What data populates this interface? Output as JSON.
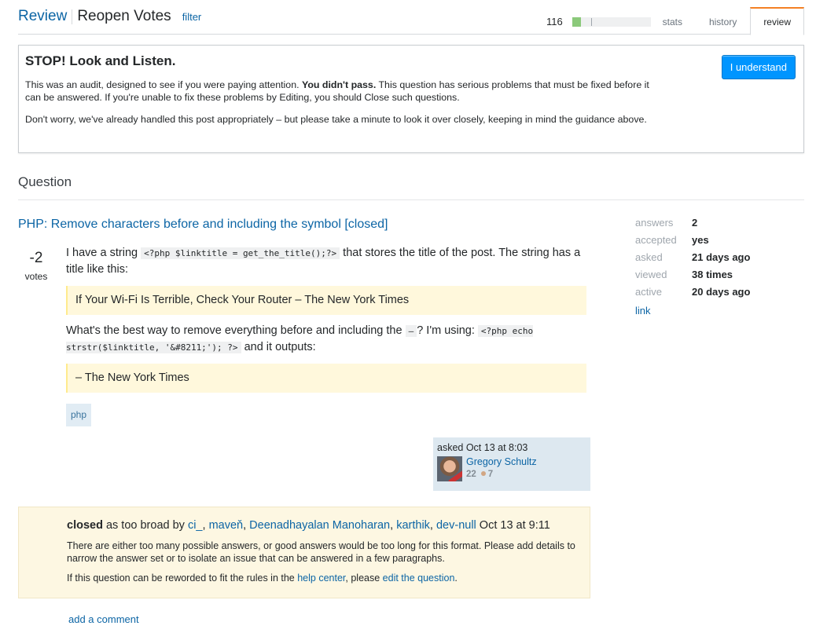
{
  "header": {
    "review_link": "Review",
    "queue_title": "Reopen Votes",
    "filter_link": "filter",
    "progress": {
      "count": "116",
      "fill_fraction": 0.11,
      "tick_fraction": 0.24
    },
    "tabs": [
      {
        "label": "stats",
        "active": false
      },
      {
        "label": "history",
        "active": false
      },
      {
        "label": "review",
        "active": true
      }
    ]
  },
  "audit": {
    "title": "STOP! Look and Listen.",
    "p1_before": "This was an audit, designed to see if you were paying attention. ",
    "p1_bold": "You didn't pass.",
    "p1_after": " This question has serious problems that must be fixed before it can be answered. If you're unable to fix these problems by Editing, you should Close such questions.",
    "p2": "Don't worry, we've already handled this post appropriately – but please take a minute to look it over closely, keeping in mind the guidance above.",
    "button": "I understand"
  },
  "section_title": "Question",
  "question": {
    "title": "PHP: Remove characters before and including the symbol [closed]",
    "votes": "-2",
    "votes_label": "votes",
    "body": {
      "p1_a": "I have a string ",
      "p1_code": "<?php $linktitle = get_the_title();?>",
      "p1_b": " that stores the title of the post. The string has a title like this:",
      "quote1": "If Your Wi-Fi Is Terrible, Check Your Router – The New York Times",
      "p2_a": "What's the best way to remove everything before and including the ",
      "p2_code1": "–",
      "p2_b": "? I'm using: ",
      "p2_code2": "<?php echo strstr($linktitle, '&#8211;'); ?>",
      "p2_c": " and it outputs:",
      "quote2": "– The New York Times"
    },
    "tags": [
      "php"
    ],
    "owner": {
      "asked": "asked Oct 13 at 8:03",
      "name": "Gregory Schultz",
      "reputation": "22",
      "bronze_badges": "7"
    }
  },
  "stats": [
    {
      "label": "answers",
      "value": "2"
    },
    {
      "label": "accepted",
      "value": "yes"
    },
    {
      "label": "asked",
      "value": "21 days ago"
    },
    {
      "label": "viewed",
      "value": "38 times"
    },
    {
      "label": "active",
      "value": "20 days ago"
    }
  ],
  "stats_link": "link",
  "closed": {
    "status": "closed",
    "reason": " as too broad by ",
    "voters": [
      "ci_",
      "maveň",
      "Deenadhayalan Manoharan",
      "karthik",
      "dev-null"
    ],
    "date": " Oct 13 at 9:11",
    "explanation": "There are either too many possible answers, or good answers would be too long for this format. Please add details to narrow the answer set or to isolate an issue that can be answered in a few paragraphs.",
    "reword_a": "If this question can be reworded to fit the rules in the ",
    "help_center": "help center",
    "reword_b": ", please ",
    "edit_link": "edit the question",
    "reword_c": "."
  },
  "add_comment": "add a comment"
}
